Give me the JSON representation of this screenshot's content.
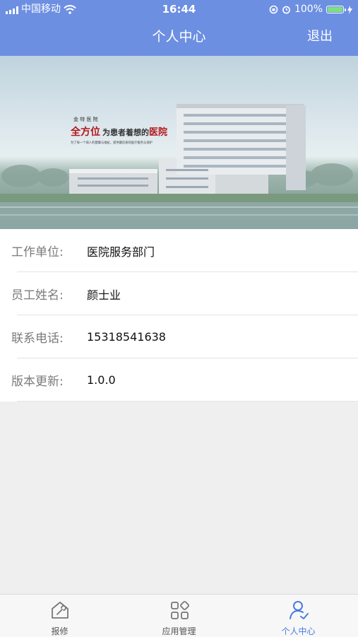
{
  "status_bar": {
    "carrier": "中国移动",
    "time": "16:44",
    "battery": "100%"
  },
  "header": {
    "title": "个人中心",
    "logout_label": "退出"
  },
  "banner": {
    "small_line": "金 特 医 院",
    "headline_red": "全方位",
    "headline_dark": "为患者着想的",
    "headline_end": "医院",
    "slogan": "为了每一个病人的健康与福祉，提供最优质的医疗服务与保护"
  },
  "profile": {
    "rows": [
      {
        "label": "工作单位:",
        "value": "医院服务部门"
      },
      {
        "label": "员工姓名:",
        "value": "颜士业"
      },
      {
        "label": "联系电话:",
        "value": "15318541638"
      },
      {
        "label": "版本更新:",
        "value": "1.0.0"
      }
    ]
  },
  "tabbar": {
    "tabs": [
      {
        "label": "报修",
        "icon": "repair-icon"
      },
      {
        "label": "应用管理",
        "icon": "apps-grid-icon"
      },
      {
        "label": "个人中心",
        "icon": "user-icon"
      }
    ],
    "active_color": "#4a7be0"
  },
  "colors": {
    "header_bg": "#6c8fe2"
  }
}
